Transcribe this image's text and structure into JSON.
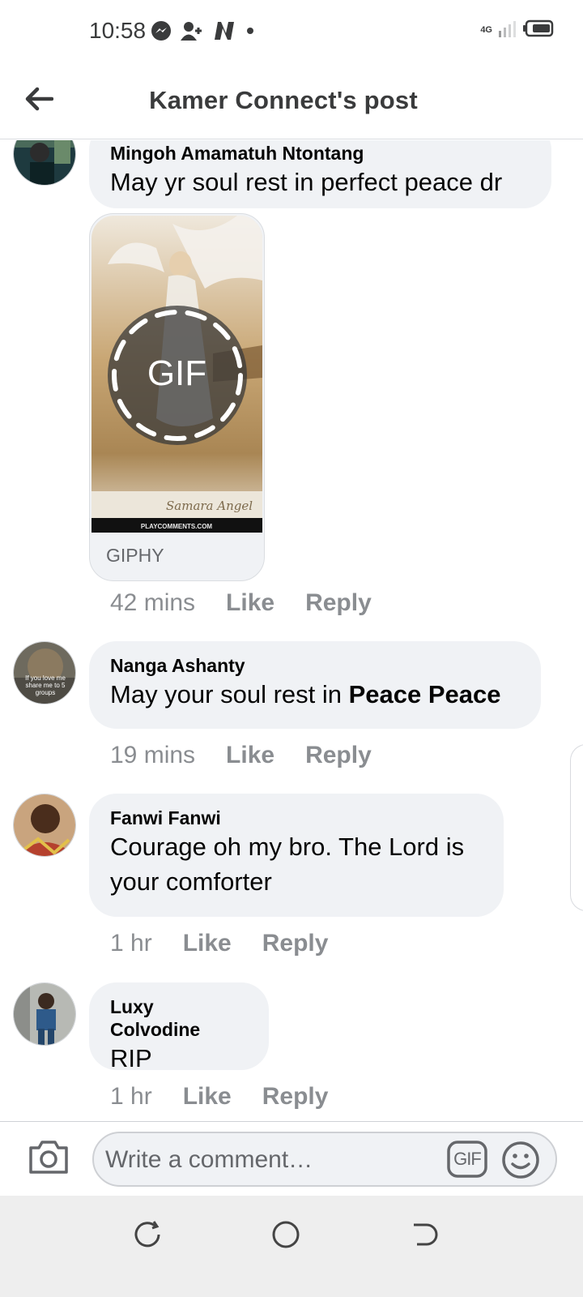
{
  "status_bar": {
    "time": "10:58",
    "network": "4G"
  },
  "header": {
    "title": "Kamer Connect's post"
  },
  "comments": [
    {
      "author": "Mingoh Amamatuh Ntontang",
      "text": "May yr soul rest in perfect peace dr",
      "attachment": {
        "badge": "GIF",
        "image_caption": "Samara Angel",
        "image_footer": "PLAYCOMMENTS.COM",
        "source": "GIPHY"
      },
      "time": "42 mins",
      "like": "Like",
      "reply": "Reply"
    },
    {
      "author": "Nanga Ashanty",
      "avatar_text": "If you love me share me to 5 groups",
      "text_plain": "May your soul rest in ",
      "text_bold": "Peace Peace",
      "time": "19 mins",
      "like": "Like",
      "reply": "Reply"
    },
    {
      "author": "Fanwi Fanwi",
      "text_line1": "Courage oh my bro. The Lord is",
      "text_line2": "your comforter",
      "time": "1 hr",
      "like": "Like",
      "reply": "Reply"
    },
    {
      "author": "Luxy Colvodine",
      "text": "RIP",
      "time": "1 hr",
      "like": "Like",
      "reply": "Reply"
    }
  ],
  "composer": {
    "placeholder": "Write a comment…",
    "gif_label": "GIF"
  },
  "colors": {
    "bubble": "#f0f2f5",
    "meta_text": "#8a8d91",
    "title_text": "#3a3b3c"
  }
}
